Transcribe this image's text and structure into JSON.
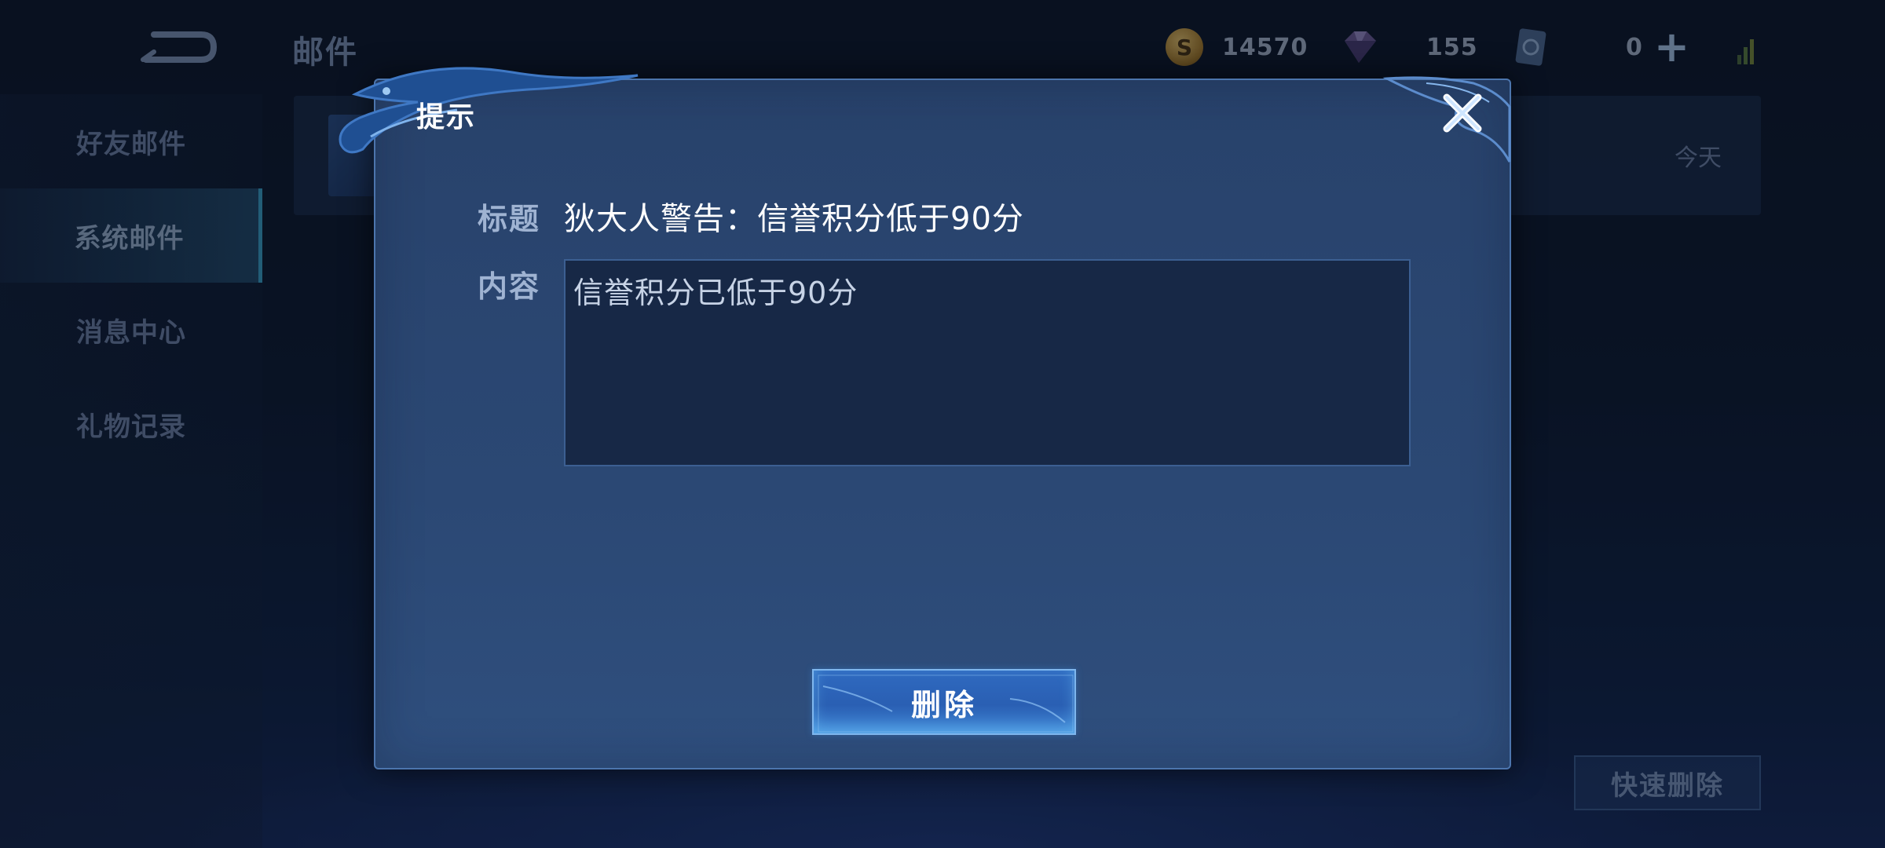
{
  "page": {
    "title": "邮件"
  },
  "currencies": [
    {
      "icon": "gold-coin-icon",
      "value": "14570"
    },
    {
      "icon": "diamond-gem-icon",
      "value": "155"
    },
    {
      "icon": "ticket-card-icon",
      "value": "0"
    }
  ],
  "sidebar": {
    "items": [
      {
        "label": "好友邮件",
        "active": false
      },
      {
        "label": "系统邮件",
        "active": true
      },
      {
        "label": "消息中心",
        "active": false
      },
      {
        "label": "礼物记录",
        "active": false
      }
    ]
  },
  "mail_list": {
    "items": [
      {
        "date": "今天"
      }
    ]
  },
  "quick_delete_label": "快速删除",
  "dialog": {
    "title": "提示",
    "subject_label": "标题",
    "subject_value": "狄大人警告：信誉积分低于90分",
    "content_label": "内容",
    "content_value": "信誉积分已低于90分",
    "delete_label": "删除"
  },
  "colors": {
    "accent": "#3ba0c7",
    "dialog_bg": "#2b4874",
    "button_blue": "#2f6ac0"
  }
}
